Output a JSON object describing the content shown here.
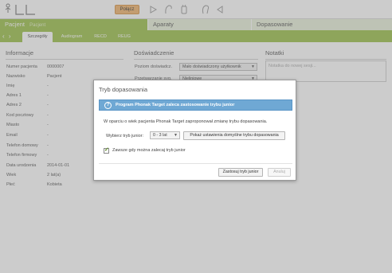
{
  "toolbar": {
    "connect_label": "Połącz",
    "icons": [
      "logo-icon",
      "play-icon",
      "hearing-aid-icon",
      "remote-icon",
      "ear-icon",
      "back-icon"
    ]
  },
  "main_tabs": {
    "pacjent": "Pacjent",
    "pacjent_sub": "Pacjent",
    "aparaty": "Aparaty",
    "dopasowanie": "Dopasowanie"
  },
  "sub_tabs": [
    "Szczegóły",
    "Audiogram",
    "RECD",
    "REUG"
  ],
  "info": {
    "title": "Informacje",
    "rows": [
      {
        "label": "Numer pacjenta",
        "value": "0000007"
      },
      {
        "label": "Nazwisko",
        "value": "Pacjent"
      },
      {
        "label": "Imię",
        "value": "-"
      },
      {
        "label": "Adres 1",
        "value": "-"
      },
      {
        "label": "Adres 2",
        "value": "-"
      },
      {
        "label": "Kod pocztowy",
        "value": "-"
      },
      {
        "label": "Miasto",
        "value": "-"
      },
      {
        "label": "Email",
        "value": "-"
      },
      {
        "label": "Telefon domowy",
        "value": "-"
      },
      {
        "label": "Telefon firmowy",
        "value": "-"
      },
      {
        "label": "Data urodzenia",
        "value": "2014-01-01"
      },
      {
        "label": "Wiek",
        "value": "2 lat(a)"
      },
      {
        "label": "Płeć",
        "value": "Kobieta"
      }
    ]
  },
  "experience": {
    "title": "Doświadczenie",
    "level_label": "Poziom doświadcz.",
    "level_value": "Mało doświadczony użytkownik",
    "proc_label": "Przetwarzanie syg.",
    "proc_value": "Nieliniowe"
  },
  "notes": {
    "title": "Notatki",
    "placeholder": "Notatka do nowej sesji..."
  },
  "dialog": {
    "title": "Tryb dopasowania",
    "banner": "Program Phonak Target zaleca zastosowanie trybu junior",
    "message": "W oparciu o wiek pacjenta Phonak Target zaproponował zmianę trybu dopasowania.",
    "mode_label": "Wybierz tryb junior:",
    "mode_value": "0 - 3 lat",
    "show_defaults_label": "Pokaż ustawienia domyślne trybu dopasowania",
    "checkbox_label": "Zawsze gdy można zalecaj tryb junior",
    "checkbox_checked": true,
    "apply_label": "Zastosuj tryb junior",
    "cancel_label": "Anuluj"
  },
  "colors": {
    "accent_green": "#9cc14a",
    "banner_blue": "#6fa8d4",
    "connect_orange": "#f0b46c"
  }
}
